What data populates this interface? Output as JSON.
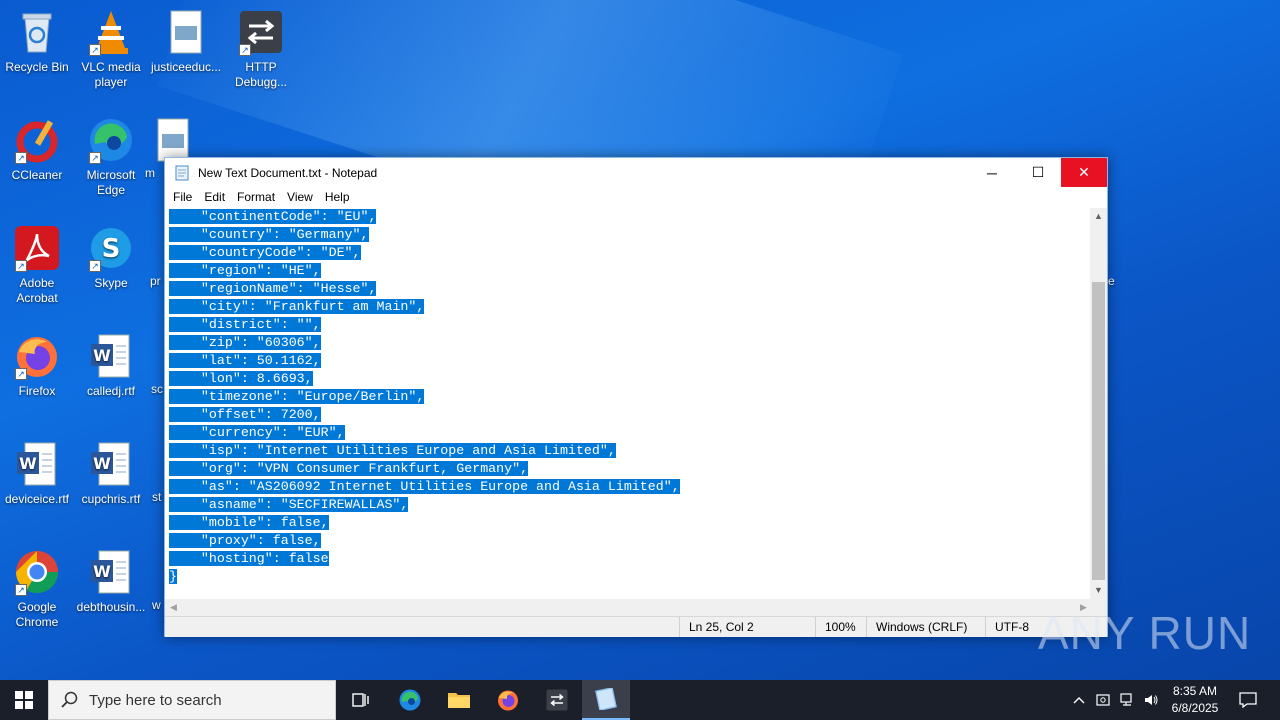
{
  "desktop": {
    "icons": [
      {
        "label": "Recycle Bin"
      },
      {
        "label": "VLC media player"
      },
      {
        "label": "justiceeduc..."
      },
      {
        "label": "HTTP Debugg..."
      },
      {
        "label": "CCleaner"
      },
      {
        "label": "Microsoft Edge"
      },
      {
        "label": "Adobe Acrobat"
      },
      {
        "label": "Skype"
      },
      {
        "label": "Firefox"
      },
      {
        "label": "calledj.rtf"
      },
      {
        "label": "deviceice.rtf"
      },
      {
        "label": "cupchris.rtf"
      },
      {
        "label": "Google Chrome"
      },
      {
        "label": "debthousin..."
      }
    ],
    "partial_labels": {
      "m": "m",
      "pr": "pr",
      "sc": "sc",
      "st": "st",
      "w": "w",
      "e": "e"
    }
  },
  "window": {
    "title": "New Text Document.txt - Notepad",
    "menu": [
      "File",
      "Edit",
      "Format",
      "View",
      "Help"
    ],
    "controls": {
      "minimize": "─",
      "maximize": "☐",
      "close": "✕"
    },
    "lines": [
      "    \"continentCode\": \"EU\",",
      "    \"country\": \"Germany\",",
      "    \"countryCode\": \"DE\",",
      "    \"region\": \"HE\",",
      "    \"regionName\": \"Hesse\",",
      "    \"city\": \"Frankfurt am Main\",",
      "    \"district\": \"\",",
      "    \"zip\": \"60306\",",
      "    \"lat\": 50.1162,",
      "    \"lon\": 8.6693,",
      "    \"timezone\": \"Europe/Berlin\",",
      "    \"offset\": 7200,",
      "    \"currency\": \"EUR\",",
      "    \"isp\": \"Internet Utilities Europe and Asia Limited\",",
      "    \"org\": \"VPN Consumer Frankfurt, Germany\",",
      "    \"as\": \"AS206092 Internet Utilities Europe and Asia Limited\",",
      "    \"asname\": \"SECFIREWALLAS\",",
      "    \"mobile\": false,",
      "    \"proxy\": false,",
      "    \"hosting\": false",
      "}"
    ],
    "status": {
      "position": "Ln 25, Col 2",
      "zoom": "100%",
      "line_ending": "Windows (CRLF)",
      "encoding": "UTF-8"
    }
  },
  "taskbar": {
    "search_placeholder": "Type here to search",
    "time": "8:35 AM",
    "date": "6/8/2025"
  },
  "watermark": "ANY RUN",
  "colors": {
    "selection": "#0078d7",
    "close_hover": "#e81123",
    "taskbar": "#1b1f2a"
  }
}
